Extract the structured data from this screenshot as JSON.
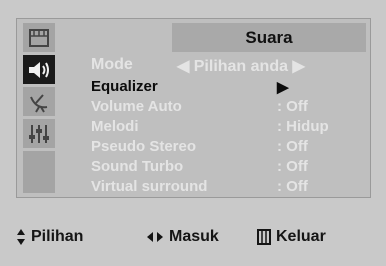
{
  "menu": {
    "title": "Suara",
    "mode": {
      "label": "Mode",
      "value": "◀ Pilihan anda ▶"
    },
    "items": [
      {
        "label": "Equalizer",
        "value": "▶"
      },
      {
        "label": "Volume Auto",
        "value": ": Off"
      },
      {
        "label": "Melodi",
        "value": ": Hidup"
      },
      {
        "label": "Pseudo Stereo",
        "value": ": Off"
      },
      {
        "label": "Sound Turbo",
        "value": ": Off"
      },
      {
        "label": "Virtual surround",
        "value": ": Off"
      }
    ]
  },
  "sidebar_icons": [
    "picture-icon",
    "speaker-icon",
    "satellite-dish-icon",
    "sliders-icon"
  ],
  "footer": {
    "select_label": "Pilihan",
    "enter_label": "Masuk",
    "exit_label": "Keluar"
  },
  "colors": {
    "background": "#c9c9c9",
    "panel": "#bfbfbf",
    "active_icon_bg": "#1a1a1a",
    "dim_text": "#e4e4e4",
    "selected_text": "#0c0c0c"
  }
}
